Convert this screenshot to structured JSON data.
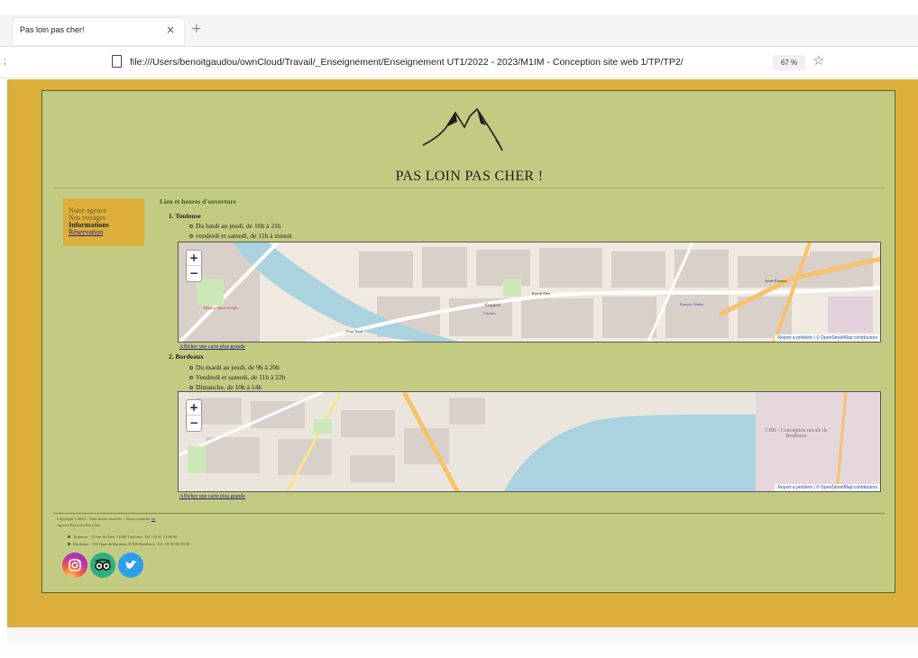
{
  "browser": {
    "tab_title": "Pas loin pas cher!",
    "tab_close": "×",
    "new_tab": "+",
    "left_mark": ";",
    "url": "file:///Users/benoitgaudou/ownCloud/Travail/_Enseignement/Enseignement UT1/2022 - 2023/M1IM - Conception site web 1/TP/TP2/",
    "zoom": "67 %"
  },
  "site": {
    "title": "PAS LOIN PAS CHER !"
  },
  "menu": {
    "items": [
      {
        "label": "Notre agence"
      },
      {
        "label": "Nos voyages"
      },
      {
        "label": "Informations"
      },
      {
        "label": "Réservation"
      }
    ]
  },
  "content": {
    "section_title": "Lieu et heures d'ouverture",
    "locations": [
      {
        "name": "1. Toulouse",
        "hours": [
          "Du lundi au jeudi, de 10h à 21h",
          "vendredi et samedi, de 11h à minuit"
        ],
        "map_labels": [
          "Hôpital Saint-Joseph",
          "Pont Neuf",
          "Esquirol",
          "Carmes",
          "Rue de Metz",
          "François Verdier",
          "Saint-Étienne"
        ],
        "big_map_link": "Afficher une carte plus grande"
      },
      {
        "name": "2. Bordeaux",
        "hours": [
          "Du mardi au jeudi, de 9h à 20h",
          "Vendredi et samedi, de 11h à 22h",
          "Dimanche, de 10h à 14h"
        ],
        "map_labels": [
          "CHB - Conception navale de Bordeaux"
        ],
        "big_map_link": "Afficher une carte plus grande"
      }
    ],
    "map_attribution": "Report a problem | © OpenStreetMap contributors",
    "zoom_in": "+",
    "zoom_out": "−"
  },
  "footer": {
    "copyright": "Copyright ©2023 – Tous droits réservés – Nous contacter",
    "contact_link": "ici",
    "agency": "Agence Pas Loin Pas Cher",
    "addresses": [
      "Toulouse : 11 rue du Taur, 31000 Toulouse. Tél : 05 61 21 00 00",
      "Bordeaux : 135 Quai de Bacalan, 33300 Bordeaux. Tél : 05 56 00 00 00"
    ],
    "social_icons": [
      "instagram-icon",
      "tripadvisor-icon",
      "twitter-icon"
    ]
  },
  "colors": {
    "page_bg": "#dcaf3c",
    "container_bg": "#c3cb82",
    "border": "#4d6b2f",
    "river": "#aad3df"
  }
}
